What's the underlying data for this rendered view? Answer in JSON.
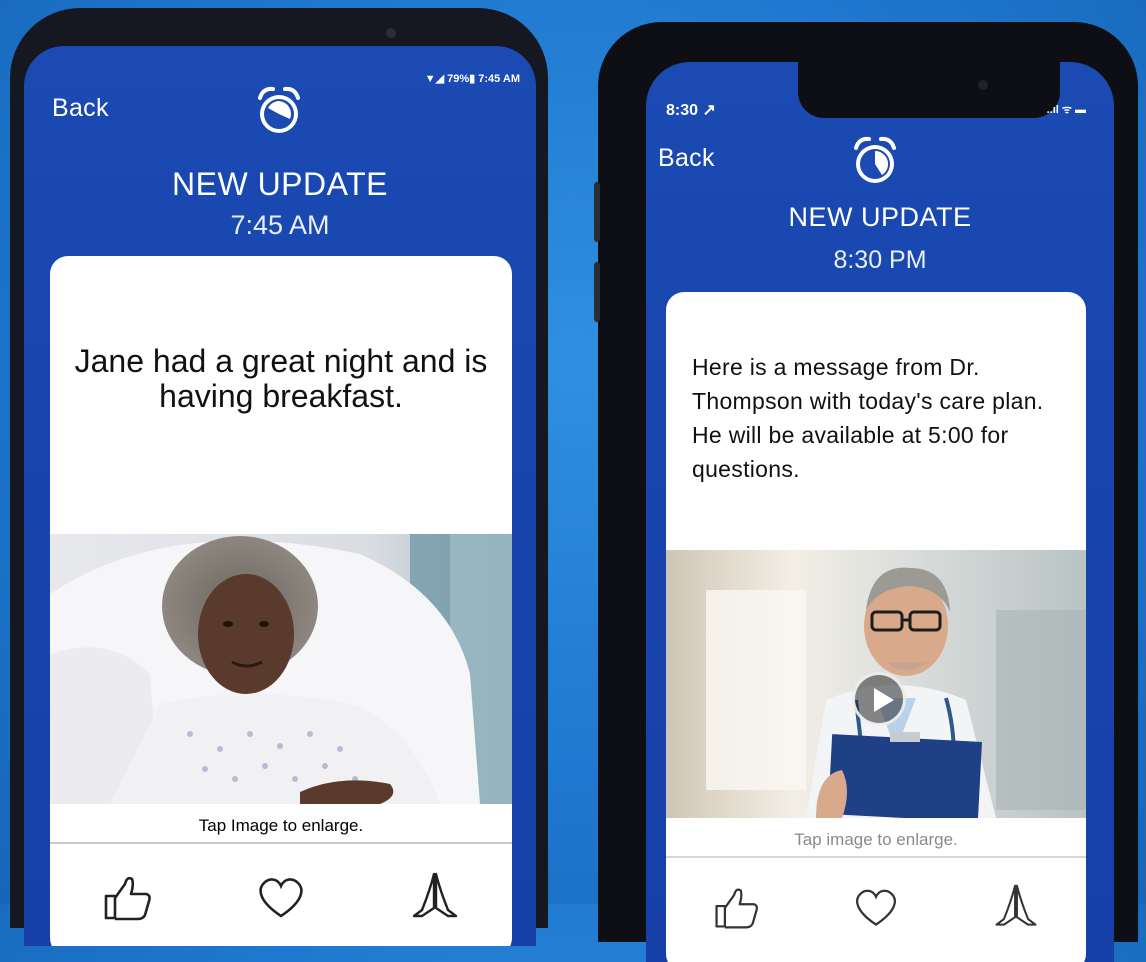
{
  "left_phone": {
    "status_icons": "▼◢ 79%▮ 7:45 AM",
    "back_label": "Back",
    "title": "NEW UPDATE",
    "time": "7:45 AM",
    "message": "Jane had a great night and is having breakfast.",
    "photo_icon": "patient-in-bed-photo",
    "caption": "Tap Image to enlarge.",
    "reactions": [
      "thumbs-up-icon",
      "heart-icon",
      "praying-hands-icon"
    ]
  },
  "right_phone": {
    "status_time": "8:30 ↗",
    "status_icons": "..ıl ᯤ ▬",
    "back_label": "Back",
    "title": "NEW UPDATE",
    "time": "8:30 PM",
    "message": "Here is a message from Dr. Thompson with today's care plan. He will be available at 5:00 for questions.",
    "photo_icon": "doctor-video-photo",
    "caption": "Tap image to enlarge.",
    "reactions": [
      "thumbs-up-icon",
      "heart-icon",
      "praying-hands-icon"
    ]
  },
  "colors": {
    "screen_blue": "#1a4ab2",
    "background_blue": "#1f78cf"
  }
}
